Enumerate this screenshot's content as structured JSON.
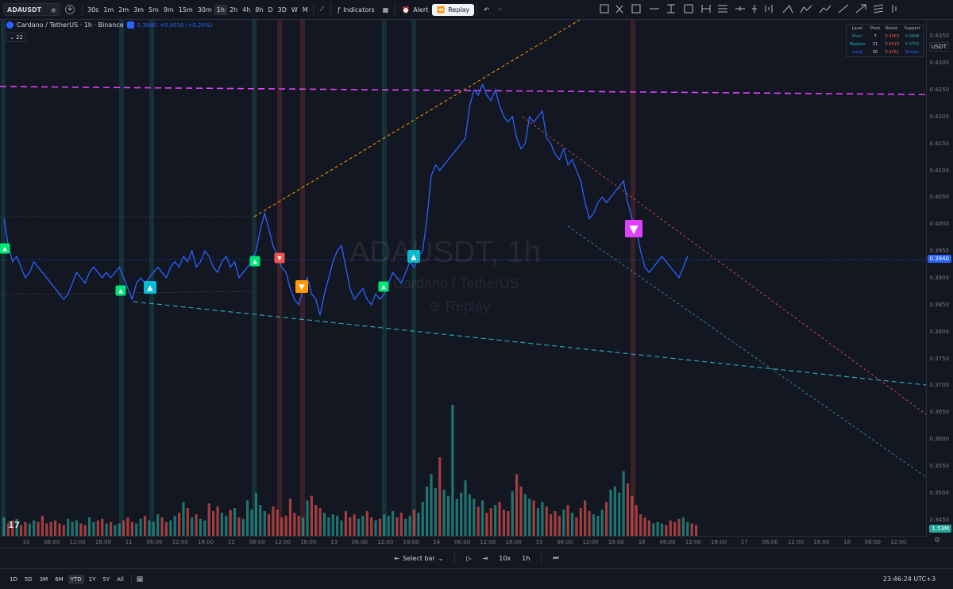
{
  "topbar": {
    "symbol": "ADAUSDT",
    "timeframes": [
      "30s",
      "1m",
      "2m",
      "3m",
      "5m",
      "9m",
      "15m",
      "30m",
      "1h",
      "2h",
      "4h",
      "8h",
      "D",
      "3D",
      "W",
      "M"
    ],
    "active_timeframe": "1h",
    "indicators_label": "Indicators",
    "alert_label": "Alert",
    "replay_label": "Replay"
  },
  "legend": {
    "name": "Cardano / TetherUS · 1h · Binance",
    "price": "0.3940",
    "change": "+0.0010 (+0.25%)",
    "indicator_count": "22"
  },
  "watermark": {
    "line1": "ADAUSDT, 1h",
    "line2": "Cardano / TetherUS",
    "line3": "Replay"
  },
  "pivot_table": {
    "headers": [
      "Level",
      "Pivot",
      "Resist.",
      "Support"
    ],
    "rows": [
      {
        "level": "Short",
        "pivot": "7",
        "resist": "0.3963",
        "support": "0.3848"
      },
      {
        "level": "Medium",
        "pivot": "21",
        "resist": "0.4510",
        "support": "0.3750"
      },
      {
        "level": "Long",
        "pivot": "50",
        "resist": "0.4251",
        "support": "Broken"
      }
    ]
  },
  "price_axis": {
    "currency": "USDT",
    "labels": [
      "0.4350",
      "0.4300",
      "0.4250",
      "0.4200",
      "0.4150",
      "0.4100",
      "0.4050",
      "0.4000",
      "0.3950",
      "0.3900",
      "0.3850",
      "0.3800",
      "0.3750",
      "0.3700",
      "0.3650",
      "0.3600",
      "0.3550",
      "0.3500",
      "0.3450"
    ],
    "current_price": "0.3940",
    "volume_tag": "1.53M"
  },
  "time_axis": {
    "labels": [
      "10",
      "06:00",
      "12:00",
      "18:00",
      "11",
      "06:00",
      "12:00",
      "18:00",
      "12",
      "06:00",
      "12:00",
      "18:00",
      "13",
      "06:00",
      "12:00",
      "18:00",
      "14",
      "06:00",
      "12:00",
      "18:00",
      "15",
      "06:00",
      "12:00",
      "18:00",
      "16",
      "06:00",
      "12:00",
      "18:00",
      "17",
      "06:00",
      "12:00",
      "18:00",
      "18",
      "06:00",
      "12:00"
    ]
  },
  "bottombar": {
    "select_bar": "Select bar",
    "speed": "10x",
    "interval": "1h"
  },
  "footbar": {
    "ranges": [
      "1D",
      "5D",
      "3M",
      "6M",
      "YTD",
      "1Y",
      "5Y",
      "All"
    ],
    "active_range": "YTD",
    "clock": "23:46:24 UTC+3"
  },
  "colors": {
    "price_line": "#2962ff",
    "bg": "#131722",
    "up": "#26a69a",
    "down": "#ef5350",
    "magenta": "#e040fb"
  },
  "chart_data": {
    "type": "line",
    "title": "ADAUSDT, 1h",
    "x_start": "10 06:00",
    "x_step_hours": 1,
    "ylim": [
      0.342,
      0.438
    ],
    "price": [
      0.401,
      0.396,
      0.393,
      0.394,
      0.392,
      0.39,
      0.391,
      0.393,
      0.392,
      0.391,
      0.39,
      0.389,
      0.388,
      0.387,
      0.386,
      0.387,
      0.389,
      0.391,
      0.39,
      0.389,
      0.391,
      0.392,
      0.391,
      0.39,
      0.391,
      0.39,
      0.391,
      0.392,
      0.39,
      0.388,
      0.386,
      0.389,
      0.39,
      0.389,
      0.39,
      0.391,
      0.392,
      0.391,
      0.39,
      0.392,
      0.393,
      0.392,
      0.394,
      0.393,
      0.395,
      0.392,
      0.393,
      0.395,
      0.394,
      0.392,
      0.391,
      0.393,
      0.394,
      0.392,
      0.393,
      0.39,
      0.391,
      0.392,
      0.393,
      0.395,
      0.399,
      0.402,
      0.399,
      0.396,
      0.394,
      0.392,
      0.391,
      0.388,
      0.386,
      0.385,
      0.388,
      0.39,
      0.387,
      0.386,
      0.383,
      0.387,
      0.39,
      0.393,
      0.395,
      0.396,
      0.392,
      0.388,
      0.386,
      0.387,
      0.388,
      0.386,
      0.385,
      0.387,
      0.386,
      0.387,
      0.389,
      0.391,
      0.39,
      0.389,
      0.391,
      0.393,
      0.392,
      0.394,
      0.395,
      0.401,
      0.409,
      0.411,
      0.41,
      0.411,
      0.412,
      0.413,
      0.414,
      0.415,
      0.416,
      0.422,
      0.425,
      0.424,
      0.426,
      0.424,
      0.423,
      0.425,
      0.422,
      0.42,
      0.419,
      0.42,
      0.416,
      0.414,
      0.415,
      0.42,
      0.419,
      0.42,
      0.421,
      0.416,
      0.415,
      0.413,
      0.412,
      0.414,
      0.411,
      0.412,
      0.41,
      0.408,
      0.404,
      0.401,
      0.402,
      0.404,
      0.405,
      0.404,
      0.405,
      0.406,
      0.407,
      0.408,
      0.404,
      0.401,
      0.399,
      0.395,
      0.392,
      0.391,
      0.392,
      0.393,
      0.394,
      0.393,
      0.392,
      0.391,
      0.39,
      0.392,
      0.394
    ],
    "volume": [
      1.2,
      0.8,
      1.0,
      1.1,
      0.7,
      0.9,
      0.8,
      1.0,
      0.9,
      1.3,
      0.8,
      0.9,
      1.0,
      0.8,
      0.7,
      1.1,
      0.9,
      1.0,
      0.8,
      0.7,
      1.2,
      0.9,
      1.0,
      1.1,
      0.8,
      0.9,
      0.7,
      0.8,
      1.0,
      1.2,
      0.9,
      0.8,
      1.1,
      1.3,
      1.0,
      0.9,
      1.4,
      1.2,
      0.9,
      1.0,
      1.3,
      1.5,
      2.2,
      1.8,
      1.2,
      1.4,
      1.1,
      1.0,
      2.1,
      1.6,
      1.9,
      1.5,
      1.3,
      1.7,
      1.8,
      1.2,
      1.1,
      2.3,
      1.7,
      2.8,
      2.0,
      1.6,
      1.4,
      1.9,
      1.7,
      1.2,
      1.3,
      2.4,
      1.5,
      1.3,
      1.2,
      2.3,
      2.6,
      2.0,
      1.8,
      1.5,
      1.2,
      1.4,
      1.3,
      1.0,
      1.6,
      1.2,
      1.4,
      1.1,
      1.3,
      1.6,
      1.2,
      1.0,
      1.1,
      1.4,
      1.3,
      1.6,
      1.2,
      1.5,
      1.1,
      1.3,
      1.7,
      1.5,
      2.2,
      3.2,
      4.0,
      3.1,
      5.1,
      3.0,
      2.6,
      8.5,
      2.4,
      2.8,
      3.6,
      2.7,
      2.4,
      1.9,
      2.3,
      1.5,
      1.8,
      2.0,
      2.2,
      1.7,
      1.6,
      2.9,
      4.0,
      3.2,
      2.7,
      2.4,
      2.3,
      1.8,
      2.2,
      1.9,
      1.4,
      1.6,
      1.3,
      1.7,
      2.0,
      1.5,
      1.2,
      1.8,
      2.3,
      1.6,
      1.4,
      1.3,
      1.7,
      2.2,
      3.0,
      3.2,
      2.8,
      4.2,
      3.4,
      2.6,
      2.0,
      1.4,
      1.2,
      1.0,
      0.8,
      0.9,
      0.8,
      0.7,
      1.0,
      0.9,
      1.1,
      1.2,
      0.9,
      0.8,
      0.7
    ]
  }
}
